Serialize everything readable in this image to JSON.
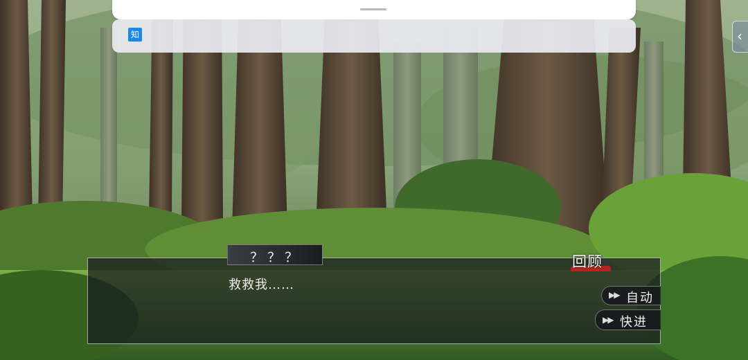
{
  "overlay": {
    "badge_text": "知"
  },
  "side_tab": {
    "icon": "chevron-left-icon",
    "glyph": "‹"
  },
  "dialogue": {
    "speaker": "？？？",
    "line": "救救我……"
  },
  "controls": {
    "review_label": "回顾",
    "auto_label": "自动",
    "fast_forward_label": "快进",
    "ff_icon": "fast-forward-icon"
  },
  "colors": {
    "accent_red": "#b9231f",
    "badge_blue": "#1e88e5"
  }
}
